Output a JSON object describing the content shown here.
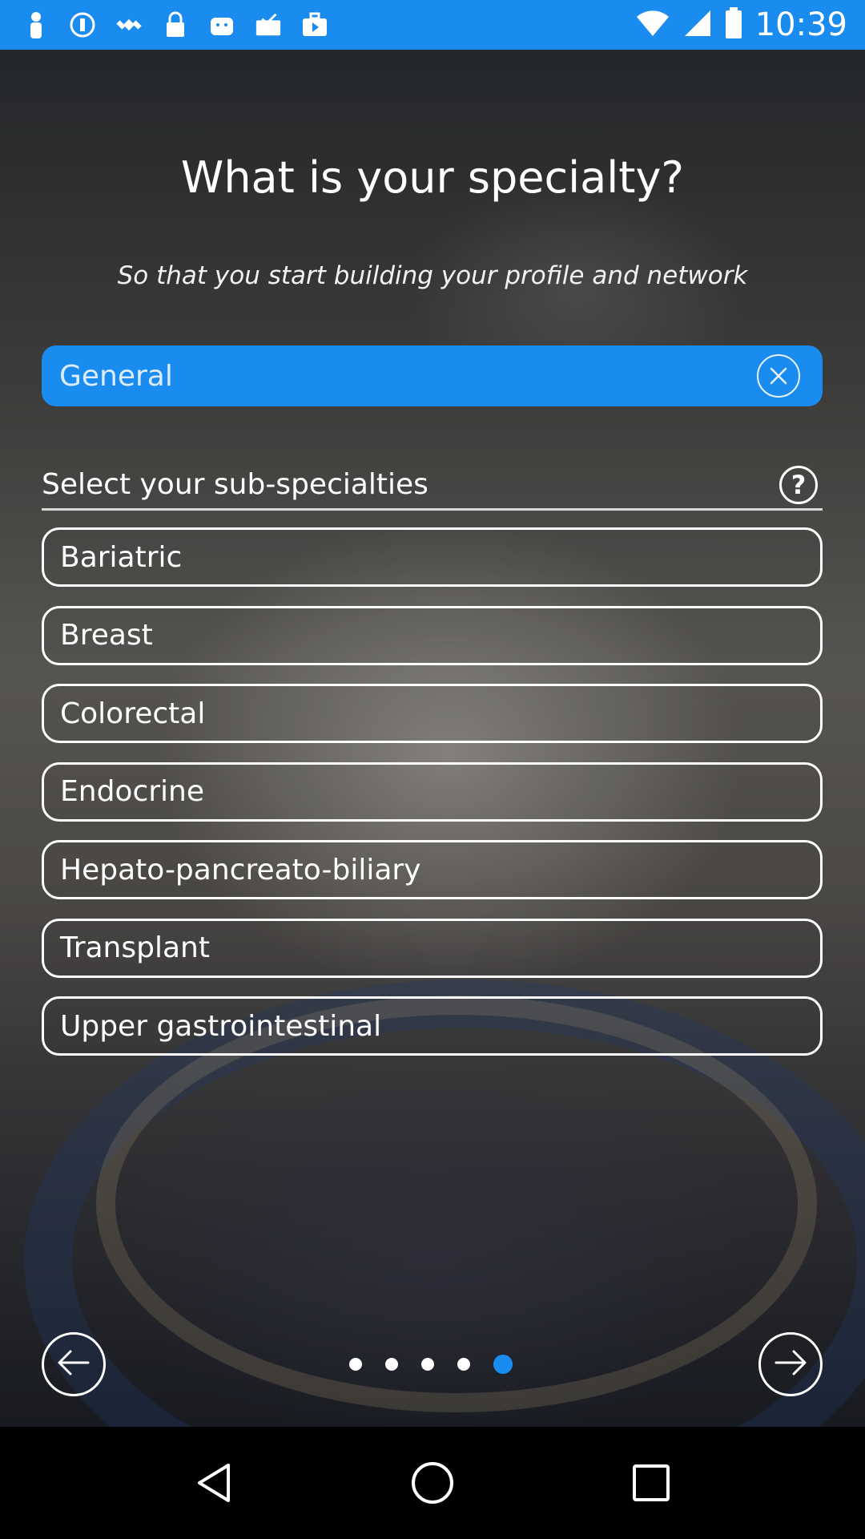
{
  "status_bar": {
    "time": "10:39",
    "left_icons": [
      "person-icon",
      "info-icon",
      "satellite-icon",
      "lock-icon",
      "android-icon",
      "mail-check-icon",
      "briefcase-play-icon"
    ],
    "right_icons": [
      "wifi-icon",
      "signal-icon",
      "battery-icon"
    ]
  },
  "screen": {
    "title": "What is your specialty?",
    "subtitle": "So that you start building your profile and network"
  },
  "selected_specialty": {
    "value": "General",
    "clear_icon": "close-circle-icon"
  },
  "sub_specialties": {
    "header": "Select your sub-specialties",
    "help_label": "?",
    "options": [
      "Bariatric",
      "Breast",
      "Colorectal",
      "Endocrine",
      "Hepato-pancreato-biliary",
      "Transplant",
      "Upper gastrointestinal"
    ]
  },
  "pager": {
    "total_pages": 5,
    "current_page": 5
  },
  "navigation": {
    "back_icon": "arrow-left-icon",
    "next_icon": "arrow-right-icon"
  },
  "colors": {
    "accent": "#1a8cf0",
    "text": "#ffffff"
  }
}
